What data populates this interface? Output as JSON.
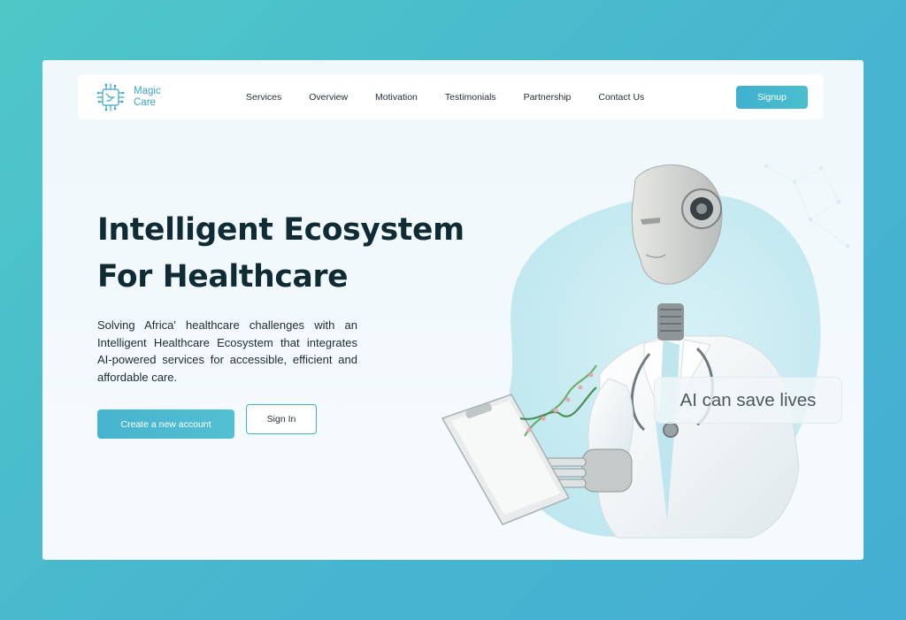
{
  "brand": {
    "line1": "Magic",
    "line2": "Care"
  },
  "nav": {
    "items": [
      "Services",
      "Overview",
      "Motivation",
      "Testimonials",
      "Partnership",
      "Contact Us"
    ],
    "signup_label": "Signup"
  },
  "hero": {
    "title_line1": "Intelligent Ecosystem",
    "title_line2": "For Healthcare",
    "description": "Solving Africa' healthcare challenges with an Intelligent Healthcare Ecosystem that integrates AI-powered services for accessible, efficient and affordable care.",
    "primary_cta": "Create a new account",
    "secondary_cta": "Sign In",
    "badge_text": "AI can save lives"
  },
  "colors": {
    "background": "#4cbdd0",
    "accent": "#45b3cf",
    "heading": "#0f2b34",
    "blob": "#c6ecf2"
  },
  "icons": [
    "chip-circuit-icon"
  ]
}
